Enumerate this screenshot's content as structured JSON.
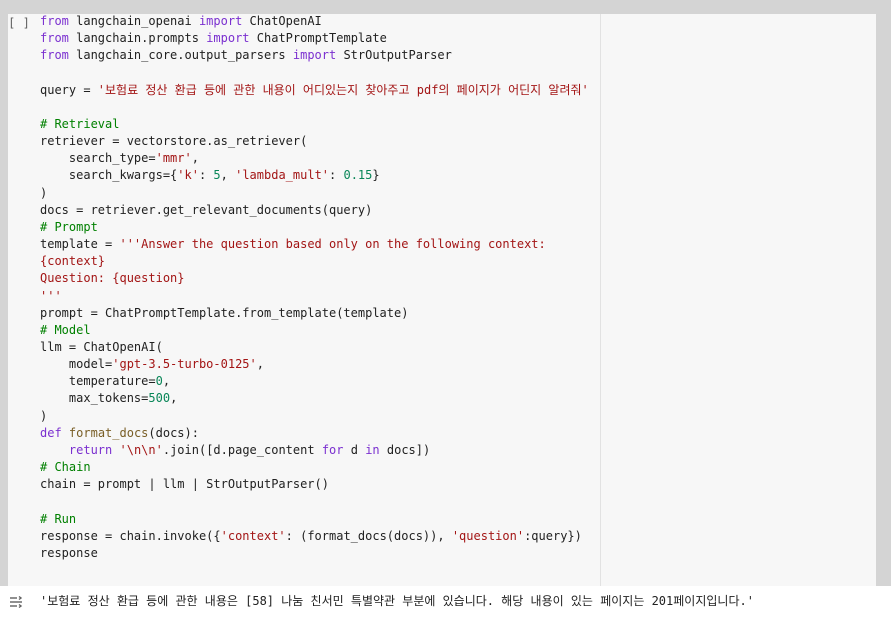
{
  "cell": {
    "run_label": "[ ]",
    "code_lines": [
      "from langchain_openai import ChatOpenAI",
      "from langchain.prompts import ChatPromptTemplate",
      "from langchain_core.output_parsers import StrOutputParser",
      "",
      "query = '보험료 정산 환급 등에 관한 내용이 어디있는지 찾아주고 pdf의 페이지가 어딘지 알려줘'",
      "",
      "# Retrieval",
      "retriever = vectorstore.as_retriever(",
      "    search_type='mmr',",
      "    search_kwargs={'k': 5, 'lambda_mult': 0.15}",
      ")",
      "docs = retriever.get_relevant_documents(query)",
      "# Prompt",
      "template = '''Answer the question based only on the following context:",
      "{context}",
      "Question: {question}",
      "'''",
      "prompt = ChatPromptTemplate.from_template(template)",
      "# Model",
      "llm = ChatOpenAI(",
      "    model='gpt-3.5-turbo-0125',",
      "    temperature=0,",
      "    max_tokens=500,",
      ")",
      "def format_docs(docs):",
      "    return '\\n\\n'.join([d.page_content for d in docs])",
      "# Chain",
      "chain = prompt | llm | StrOutputParser()",
      "",
      "# Run",
      "response = chain.invoke({'context': (format_docs(docs)), 'question':query})",
      "response"
    ]
  },
  "output": {
    "icon": "output-settings-icon",
    "text": "'보험료 정산 환급 등에 관한 내용은 [58] 나눔 친서민 특별약관 부분에 있습니다. 해당 내용이 있는 페이지는 201페이지입니다.'"
  },
  "colors": {
    "keyword": "#7b30d0",
    "string": "#a31515",
    "comment": "#008000",
    "number": "#098658",
    "function": "#795e26"
  }
}
